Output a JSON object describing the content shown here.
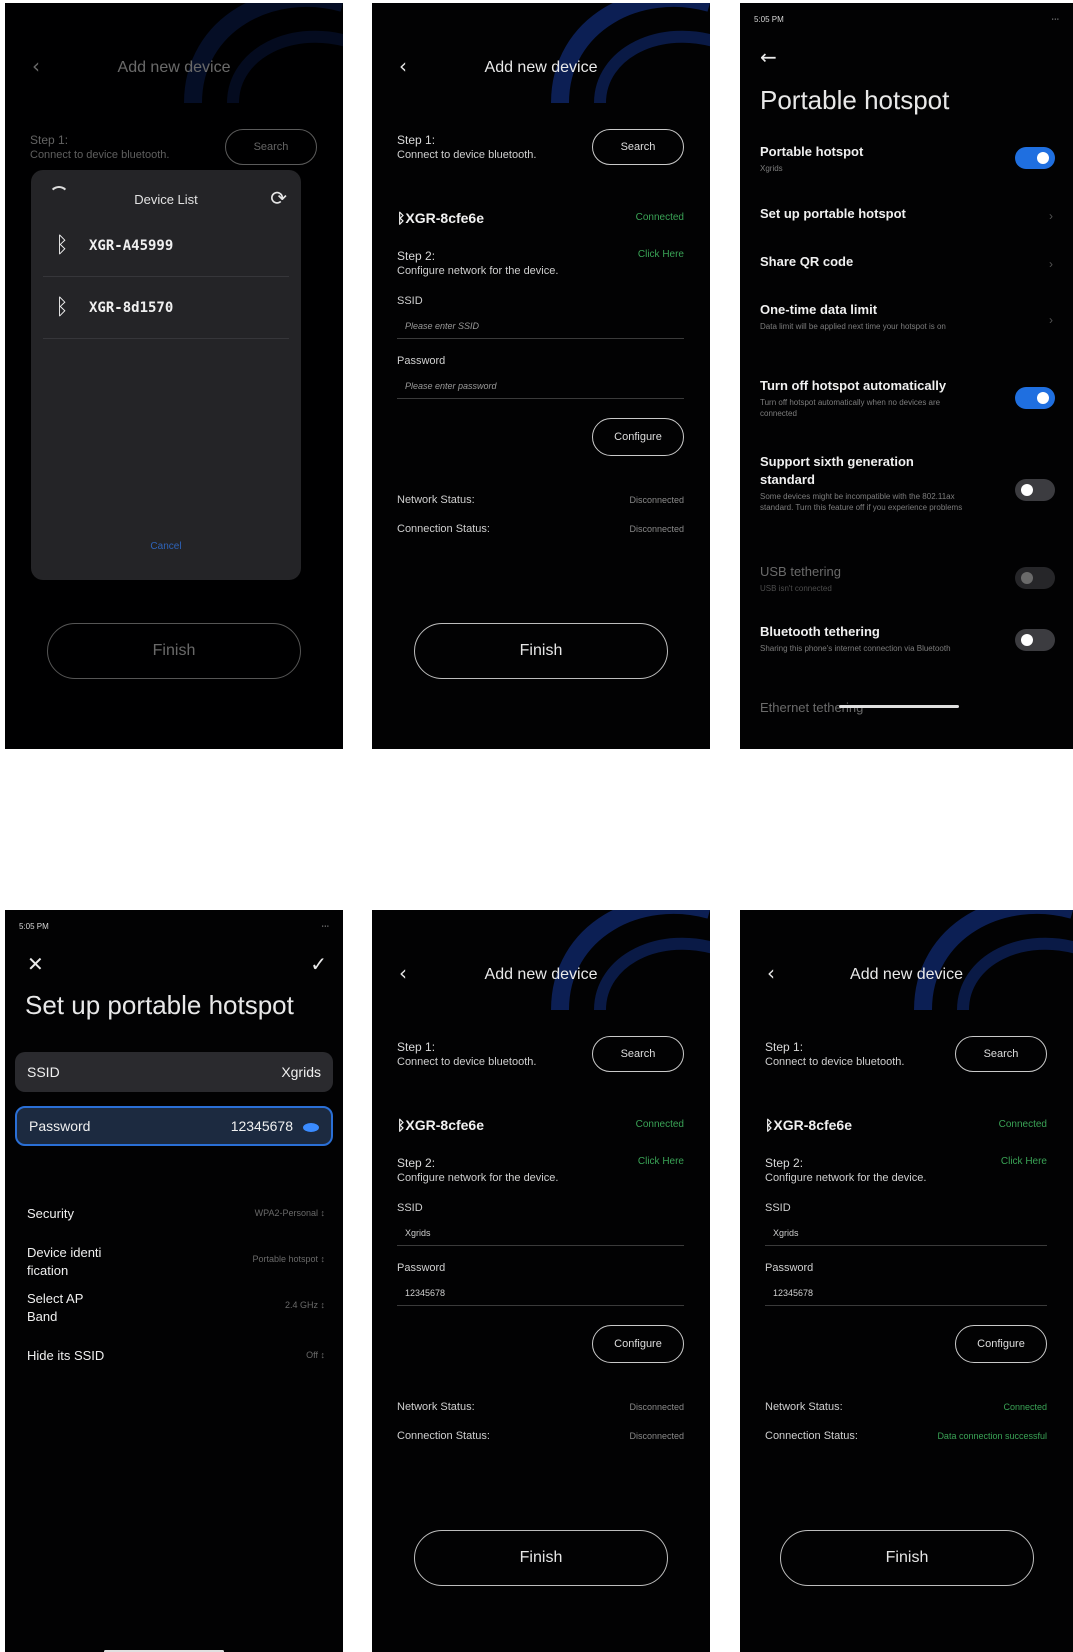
{
  "colors": {
    "background": "#020203",
    "accent_green": "#3aa356",
    "toggle_blue": "#1f6fe0"
  },
  "add_device": {
    "title": "Add new device",
    "step1_title": "Step 1:",
    "step1_sub": "Connect to device bluetooth.",
    "search_label": "Search",
    "device_name": "XGR-8cfe6e",
    "connected_label": "Connected",
    "step2_title": "Step 2:",
    "step2_sub": "Configure network for the device.",
    "click_here": "Click Here",
    "ssid_label": "SSID",
    "ssid_placeholder": "Please enter SSID",
    "password_label": "Password",
    "password_placeholder": "Please enter password",
    "ssid_value": "Xgrids",
    "password_value": "12345678",
    "configure_label": "Configure",
    "network_status_label": "Network Status:",
    "connection_status_label": "Connection Status:",
    "disconnected": "Disconnected",
    "network_connected": "Connected",
    "data_connection_success": "Data connection successful",
    "finish_label": "Finish"
  },
  "device_list": {
    "title": "Device List",
    "items": [
      "XGR-A45999",
      "XGR-8d1570"
    ],
    "cancel_label": "Cancel"
  },
  "status_bar": {
    "time": "5:05 PM",
    "icons": "⋅⋅⋅"
  },
  "portable_hotspot": {
    "title": "Portable hotspot",
    "rows": [
      {
        "title": "Portable hotspot",
        "sub": "Xgrids",
        "toggle": "on"
      },
      {
        "title": "Set up portable hotspot",
        "sub": ""
      },
      {
        "title": "Share QR code",
        "sub": ""
      },
      {
        "title": "One-time data limit",
        "sub": "Data limit will be applied next time your hotspot is on"
      },
      {
        "title": "Turn off hotspot automatically",
        "sub": "Turn off hotspot automatically when no devices are connected",
        "toggle": "on"
      },
      {
        "title": "Support sixth generation standard",
        "sub": "Some devices might be incompatible with the 802.11ax standard. Turn this feature off if you experience problems",
        "toggle": "off"
      },
      {
        "title": "USB tethering",
        "sub": "USB isn't connected",
        "toggle": "disabled"
      },
      {
        "title": "Bluetooth tethering",
        "sub": "Sharing this phone's internet connection via Bluetooth",
        "toggle": "off"
      },
      {
        "title": "Ethernet tethering",
        "sub": ""
      }
    ]
  },
  "setup_hotspot": {
    "title": "Set up portable hotspot",
    "ssid_label": "SSID",
    "ssid_value": "Xgrids",
    "password_label": "Password",
    "password_value": "12345678",
    "options": [
      {
        "label": "Security",
        "value": "WPA2-Personal ↕"
      },
      {
        "label": "Device identi fication",
        "value": "Portable hotspot ↕"
      },
      {
        "label": "Select AP Band",
        "value": "2.4 GHz ↕"
      },
      {
        "label": "Hide its SSID",
        "value": "Off ↕"
      }
    ]
  },
  "icons": [
    "back-icon",
    "bluetooth-icon",
    "refresh-icon",
    "spinner-icon",
    "close-icon",
    "check-icon",
    "eye-icon",
    "chevron-right-icon"
  ]
}
